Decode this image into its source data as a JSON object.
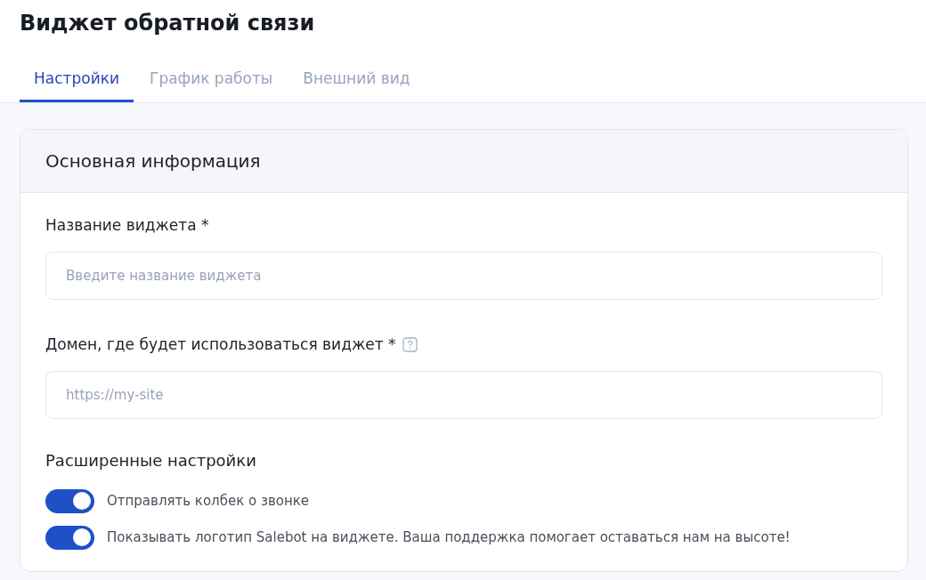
{
  "title": "Виджет обратной связи",
  "tabs": [
    {
      "label": "Настройки",
      "selected": true
    },
    {
      "label": "График работы",
      "selected": false
    },
    {
      "label": "Внешний вид",
      "selected": false
    }
  ],
  "card": {
    "header": "Основная информация",
    "fields": [
      {
        "label": "Название виджета *",
        "placeholder": "Введите название виджета",
        "help": false
      },
      {
        "label": "Домен, где будет использоваться виджет *",
        "placeholder": "https://my-site",
        "help": true
      }
    ],
    "advanced_title": "Расширенные настройки",
    "toggles": [
      {
        "label": "Отправлять колбек о звонке",
        "on": true
      },
      {
        "label": "Показывать логотип Salebot на виджете. Ваша поддержка помогает оставаться нам на высоте!",
        "on": true
      }
    ]
  }
}
